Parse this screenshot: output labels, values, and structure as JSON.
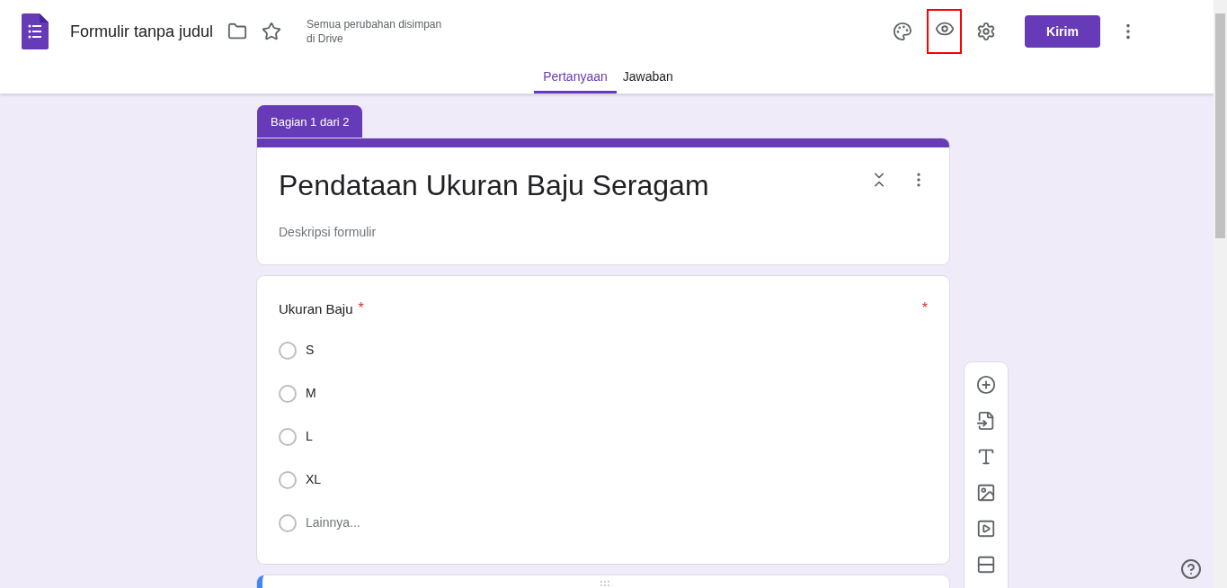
{
  "header": {
    "title": "Formulir tanpa judul",
    "save_status": "Semua perubahan disimpan di Drive",
    "send_button": "Kirim"
  },
  "tabs": [
    {
      "label": "Pertanyaan",
      "selected": true
    },
    {
      "label": "Jawaban",
      "selected": false
    }
  ],
  "section_tab": "Bagian 1 dari 2",
  "form": {
    "title": "Pendataan Ukuran Baju Seragam",
    "description_placeholder": "Deskripsi formulir"
  },
  "question": {
    "title": "Ukuran Baju",
    "title_mark": "*",
    "corner_mark": "*",
    "required": true,
    "options": [
      {
        "label": "S",
        "kind": "option",
        "selected": false
      },
      {
        "label": "M",
        "kind": "option",
        "selected": false
      },
      {
        "label": "L",
        "kind": "option",
        "selected": false
      },
      {
        "label": "XL",
        "kind": "option",
        "selected": false
      },
      {
        "label": "Lainnya...",
        "kind": "other",
        "selected": false
      }
    ]
  }
}
